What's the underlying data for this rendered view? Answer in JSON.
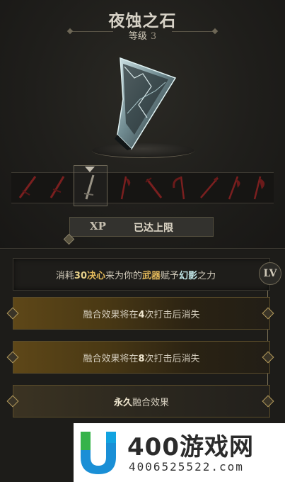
{
  "header": {
    "title": "夜蚀之石",
    "level_label": "等级",
    "level_value": "3"
  },
  "xp": {
    "tag": "XP",
    "status": "已达上限"
  },
  "description": {
    "parts": [
      "消耗",
      "30",
      "决心",
      "来为你的",
      "武器",
      "赋予",
      "幻影",
      "之力"
    ]
  },
  "lv_badge": "LV",
  "effects": [
    {
      "pre": "融合效果将在",
      "num": "4",
      "post": "次打击后消失"
    },
    {
      "pre": "融合效果将在",
      "num": "8",
      "post": "次打击后消失"
    },
    {
      "strong": "永久",
      "post": "融合效果"
    }
  ],
  "weapons": [
    {
      "name": "weapon-slot-1",
      "icon": "sword-icon"
    },
    {
      "name": "weapon-slot-2",
      "icon": "sword-icon"
    },
    {
      "name": "weapon-slot-3",
      "icon": "sword-icon"
    },
    {
      "name": "weapon-slot-4",
      "icon": "axe-icon"
    },
    {
      "name": "weapon-slot-5",
      "icon": "blade-icon"
    },
    {
      "name": "weapon-slot-6",
      "icon": "scythe-icon"
    },
    {
      "name": "weapon-slot-7",
      "icon": "spear-icon"
    },
    {
      "name": "weapon-slot-8",
      "icon": "halberd-icon"
    },
    {
      "name": "weapon-slot-9",
      "icon": "axe-icon"
    }
  ],
  "watermark": {
    "title": "400游戏网",
    "phone": "4006525522.com"
  },
  "colors": {
    "accent_gold": "#e3b95a",
    "accent_cyan": "#bfe3e4",
    "weapon_red": "#7a1f1f"
  }
}
